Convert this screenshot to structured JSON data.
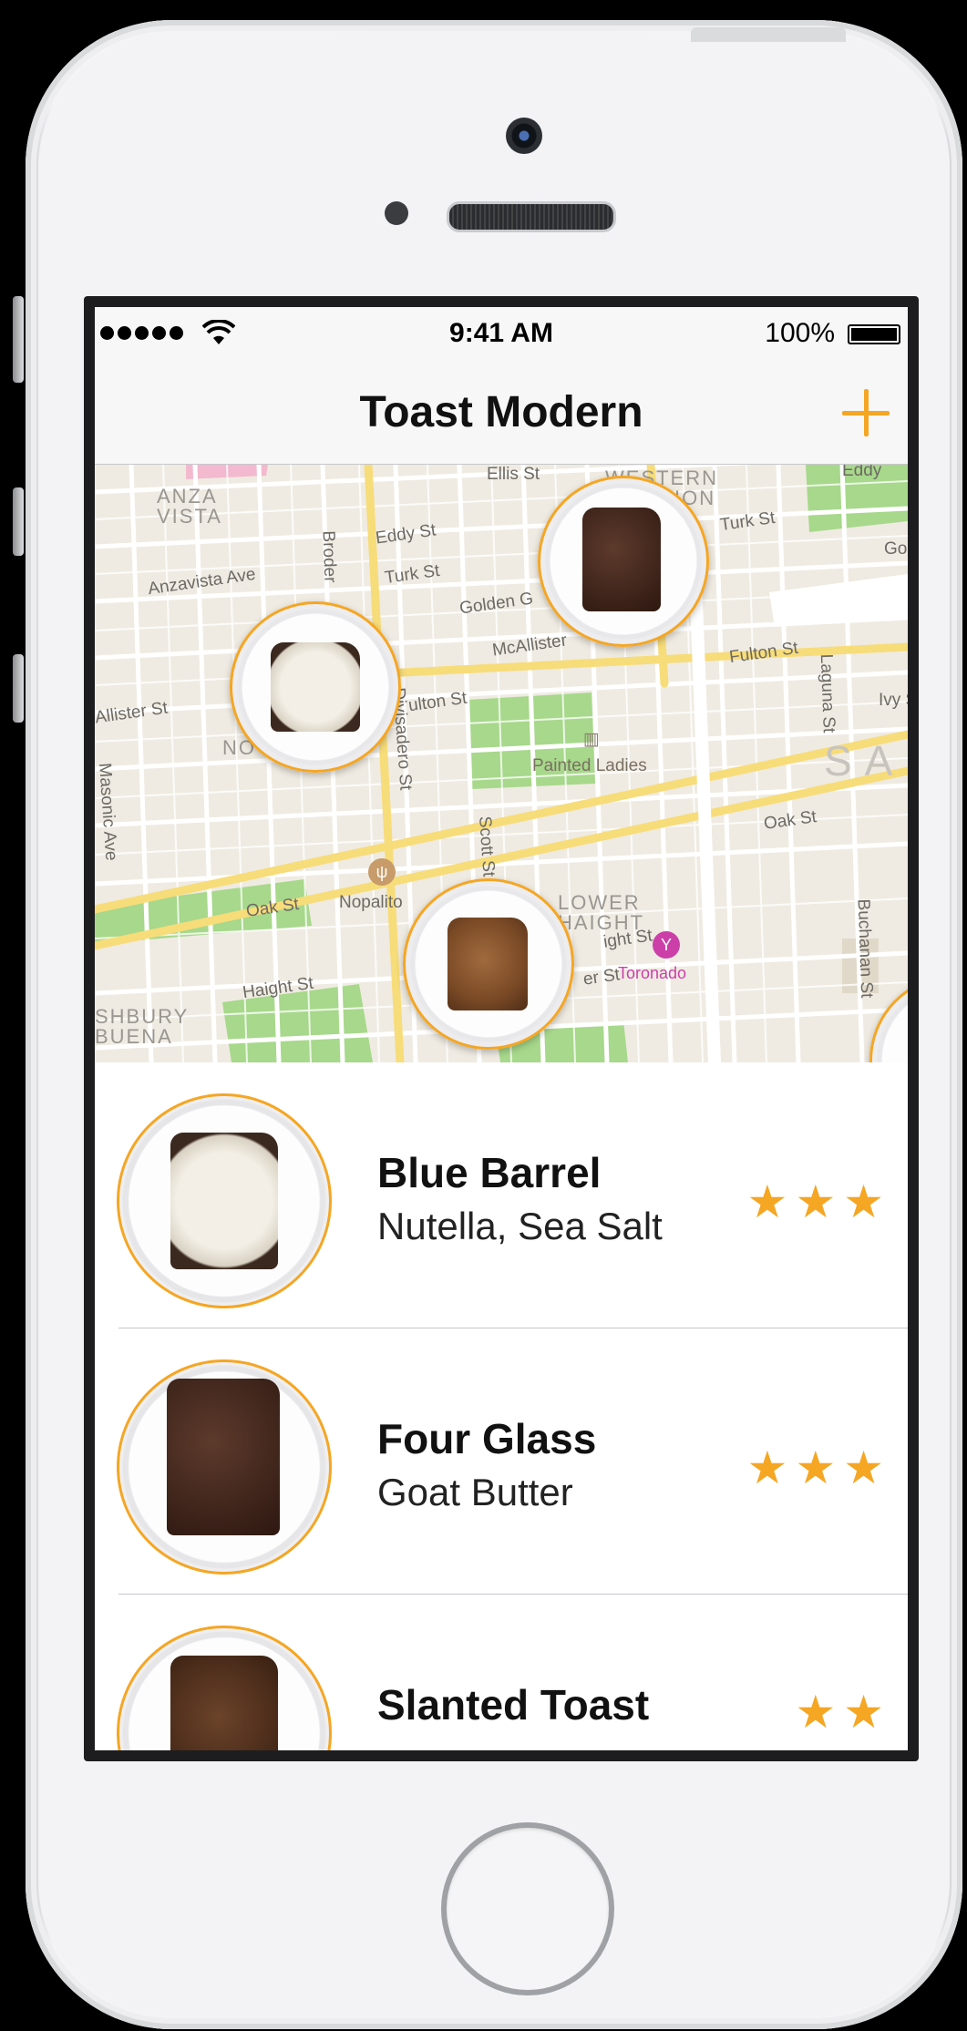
{
  "status_bar": {
    "time": "9:41 AM",
    "battery": "100%",
    "battery_level": 1.0,
    "signal_bars": 5
  },
  "nav": {
    "title": "Toast Modern",
    "add_icon": "plus-icon"
  },
  "map": {
    "labels": {
      "anza_vista": "ANZA\nVISTA",
      "western_addition": "WESTERN\nADDITION",
      "nopa": "NO",
      "lower_haight": "LOWER\nHAIGHT",
      "haight_ashbury": "SHBURY\nBUENA",
      "sf": "SA",
      "ellis": "Ellis St",
      "eddy": "Eddy St",
      "eddy_right": "Eddy",
      "turk_left": "Turk St",
      "turk_right": "Turk St",
      "golden_gate": "Golden G",
      "mcallister_left": "Allister St",
      "mcallister_right": "McAllister",
      "fulton_left": "ulton St",
      "fulton_right": "Fulton St",
      "anzavista_ave": "Anzavista Ave",
      "broderick": "Broder",
      "divisadero": "Divisadero St",
      "masonic": "Masonic Ave",
      "scott": "Scott St",
      "laguna": "Laguna St",
      "buchanan": "Buchanan St",
      "ivy": "Ivy S",
      "oak_left": "Oak St",
      "oak_right": "Oak St",
      "haight_left": "Haight St",
      "haight_right": "ight St",
      "page": "er St",
      "go": "Go",
      "painted_ladies": "Painted Ladies",
      "nopalito": "Nopalito",
      "toronado": "Toronado"
    }
  },
  "toasts": [
    {
      "name": "Blue Barrel",
      "description": "Nutella, Sea Salt",
      "rating": "★★★"
    },
    {
      "name": "Four Glass",
      "description": "Goat Butter",
      "rating": "★★★"
    },
    {
      "name": "Slanted Toast",
      "description": "",
      "rating": "★★"
    }
  ]
}
